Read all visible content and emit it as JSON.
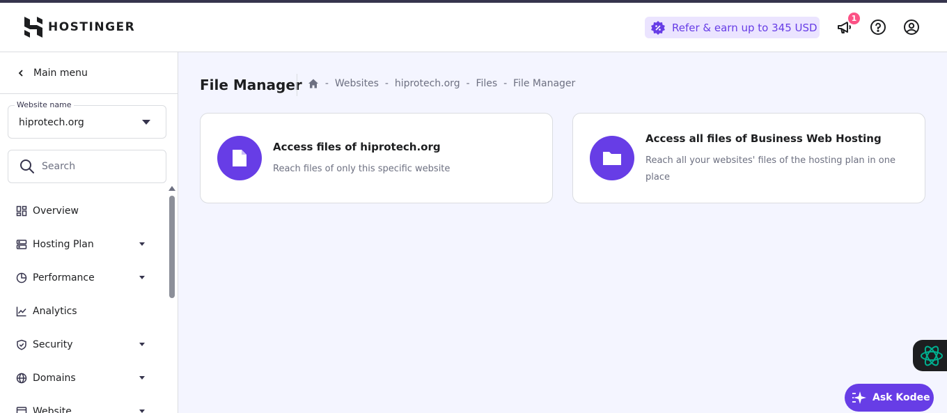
{
  "header": {
    "logo_text": "HOSTINGER",
    "refer_label": "Refer & earn up to 345 USD",
    "notification_count": "1"
  },
  "sidebar": {
    "main_menu_label": "Main menu",
    "website_select": {
      "legend": "Website name",
      "value": "hiprotech.org"
    },
    "search_placeholder": "Search",
    "items": [
      {
        "label": "Overview",
        "icon": "overview-icon",
        "has_caret": false
      },
      {
        "label": "Hosting Plan",
        "icon": "server-icon",
        "has_caret": true
      },
      {
        "label": "Performance",
        "icon": "pie-chart-icon",
        "has_caret": true
      },
      {
        "label": "Analytics",
        "icon": "analytics-icon",
        "has_caret": false
      },
      {
        "label": "Security",
        "icon": "shield-icon",
        "has_caret": true
      },
      {
        "label": "Domains",
        "icon": "globe-icon",
        "has_caret": true
      },
      {
        "label": "Website",
        "icon": "browser-icon",
        "has_caret": true
      }
    ]
  },
  "main": {
    "title": "File Manager",
    "breadcrumb": [
      "Websites",
      "hiprotech.org",
      "Files",
      "File Manager"
    ],
    "cards": [
      {
        "title": "Access files of hiprotech.org",
        "description": "Reach files of only this specific website"
      },
      {
        "title": "Access all files of Business Web Hosting",
        "description": "Reach all your websites' files of the hosting plan in one place"
      }
    ]
  },
  "kodee": {
    "ask_label": "Ask Kodee"
  },
  "colors": {
    "accent": "#673de6",
    "accent_light": "#ebe4ff",
    "badge": "#fc5185",
    "text_dark": "#1d1e20",
    "text_muted": "#6d7081",
    "page_bg": "#f4f5ff",
    "kodee_green": "#00b090"
  }
}
